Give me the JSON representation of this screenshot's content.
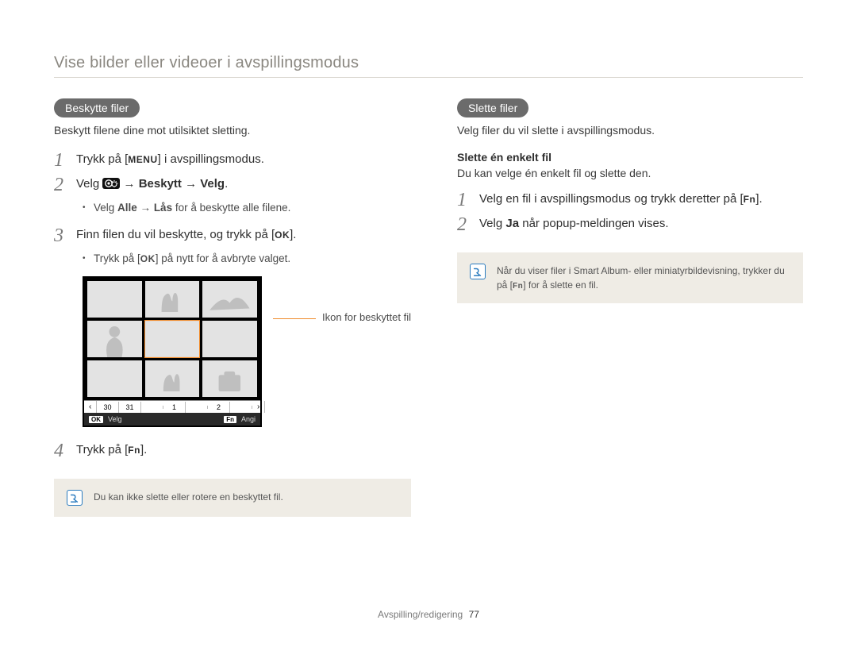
{
  "page_title": "Vise bilder eller videoer i avspillingsmodus",
  "left": {
    "pill": "Beskytte filer",
    "intro": "Beskytt filene dine mot utilsiktet sletting.",
    "step1_a": "Trykk på [",
    "step1_btn": "MENU",
    "step1_b": "] i avspillingsmodus.",
    "step2_a": "Velg ",
    "step2_b": " → Beskytt → Velg",
    "step2_c": ".",
    "bullet1_a": "Velg ",
    "bullet1_b": "Alle",
    "bullet1_c": " → ",
    "bullet1_d": "Lås",
    "bullet1_e": " for å beskytte alle filene.",
    "step3_a": "Finn filen du vil beskytte, og trykk på [",
    "step3_btn": "OK",
    "step3_b": "].",
    "bullet2_a": "Trykk på [",
    "bullet2_btn": "OK",
    "bullet2_b": "] på nytt for å avbryte valget.",
    "callout": "Ikon for beskyttet fil",
    "dates": [
      "30",
      "31",
      "1",
      "2"
    ],
    "foot_ok": "OK",
    "foot_velg": "Velg",
    "foot_fn": "Fn",
    "foot_angi": "Angi",
    "step4_a": "Trykk på [",
    "step4_btn": "Fn",
    "step4_b": "].",
    "note": "Du kan ikke slette eller rotere en beskyttet fil."
  },
  "right": {
    "pill": "Slette filer",
    "intro": "Velg filer du vil slette i avspillingsmodus.",
    "subhead": "Slette én enkelt fil",
    "subtext": "Du kan velge én enkelt fil og slette den.",
    "step1_a": "Velg en fil i avspillingsmodus og trykk deretter på [",
    "step1_btn": "Fn",
    "step1_b": "].",
    "step2_a": "Velg ",
    "step2_b": "Ja",
    "step2_c": " når popup-meldingen vises.",
    "note_a": "Når du viser filer i Smart Album- eller miniatyrbildevisning, trykker du på [",
    "note_btn": "Fn",
    "note_b": "] for å slette en fil."
  },
  "footer_section": "Avspilling/redigering",
  "footer_page": "77"
}
